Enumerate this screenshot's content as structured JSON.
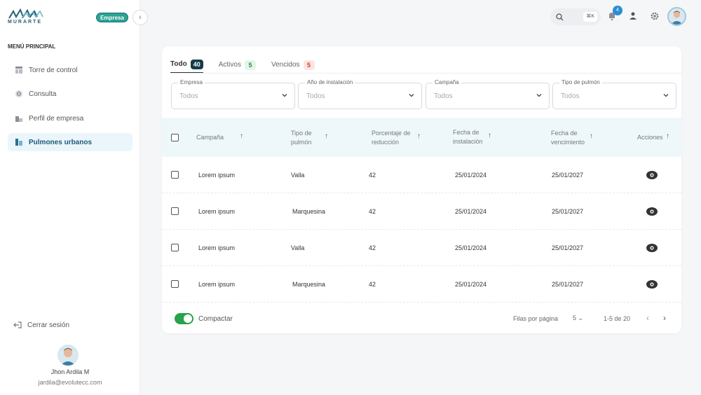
{
  "brand": {
    "name": "MURARTE",
    "badge": "Empresa"
  },
  "sidebar": {
    "menu_title": "MENÚ PRINCIPAL",
    "items": [
      {
        "label": "Torre de control",
        "icon": "control-tower-icon",
        "active": false
      },
      {
        "label": "Consulta",
        "icon": "search-doc-icon",
        "active": false
      },
      {
        "label": "Perfil de empresa",
        "icon": "company-profile-icon",
        "active": false
      },
      {
        "label": "Pulmones urbanos",
        "icon": "urban-lungs-icon",
        "active": true
      }
    ],
    "logout": "Cerrar sesión",
    "user": {
      "name": "Jhon Ardila M",
      "email": "jardila@evolutecc.com"
    }
  },
  "header": {
    "search_shortcut": "⌘K",
    "notification_count": "4"
  },
  "tabs": [
    {
      "label": "Todo",
      "count": "40",
      "style": "active"
    },
    {
      "label": "Activos",
      "count": "5",
      "style": "green"
    },
    {
      "label": "Vencidos",
      "count": "5",
      "style": "red"
    }
  ],
  "filters": [
    {
      "label": "Empresa",
      "value": "Todos"
    },
    {
      "label": "Año de instalación",
      "value": "Todos"
    },
    {
      "label": "Campaña",
      "value": "Todos"
    },
    {
      "label": "Tipo de pulmón",
      "value": "Todos"
    }
  ],
  "table": {
    "headers": {
      "campaign": "Campaña",
      "type_1": "Tipo de",
      "type_2": "pulmón",
      "reduction_1": "Porcentaje de",
      "reduction_2": "reducción",
      "install_1": "Fecha de",
      "install_2": "instalación",
      "expiry_1": "Fecha de",
      "expiry_2": "vencimiento",
      "actions": "Acciones"
    },
    "rows": [
      {
        "campaign": "Lorem ipsum",
        "type": "Valla",
        "reduction": "42",
        "install": "25/01/2024",
        "expiry": "25/01/2027"
      },
      {
        "campaign": "Lorem ipsum",
        "type": "Marquesina",
        "reduction": "42",
        "install": "25/01/2024",
        "expiry": "25/01/2027"
      },
      {
        "campaign": "Lorem ipsum",
        "type": "Valla",
        "reduction": "42",
        "install": "25/01/2024",
        "expiry": "25/01/2027"
      },
      {
        "campaign": "Lorem ipsum",
        "type": "Marquesina",
        "reduction": "42",
        "install": "25/01/2024",
        "expiry": "25/01/2027"
      }
    ]
  },
  "footer": {
    "compact_label": "Compactar",
    "rows_per_page_label": "Filas por página",
    "rows_per_page": "5",
    "range": "1-5 de 20"
  },
  "colors": {
    "accent": "#27a34a",
    "brand": "#1d5a78",
    "header_bg": "#eef8fb"
  }
}
